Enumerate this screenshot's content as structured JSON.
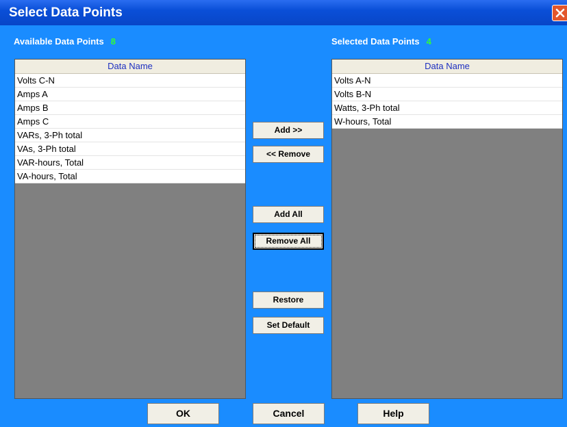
{
  "window": {
    "title": "Select Data Points"
  },
  "available": {
    "label": "Available Data Points",
    "count": "8",
    "column_header": "Data Name",
    "items": [
      "Volts C-N",
      "Amps A",
      "Amps B",
      "Amps C",
      "VARs, 3-Ph total",
      "VAs, 3-Ph total",
      "VAR-hours, Total",
      "VA-hours, Total"
    ]
  },
  "selected": {
    "label": "Selected Data Points",
    "count": "4",
    "column_header": "Data Name",
    "items": [
      "Volts A-N",
      "Volts B-N",
      "Watts, 3-Ph total",
      "W-hours, Total"
    ]
  },
  "buttons": {
    "add": "Add  >>",
    "remove": "<<  Remove",
    "add_all": "Add All",
    "remove_all": "Remove All",
    "restore": "Restore",
    "set_default": "Set Default",
    "ok": "OK",
    "cancel": "Cancel",
    "help": "Help"
  },
  "colors": {
    "background": "#1a8cff",
    "count_color": "#33ff33",
    "header_text": "#1d2fc0",
    "close_button": "#e2562c"
  },
  "icons": {
    "close": "close-icon"
  }
}
